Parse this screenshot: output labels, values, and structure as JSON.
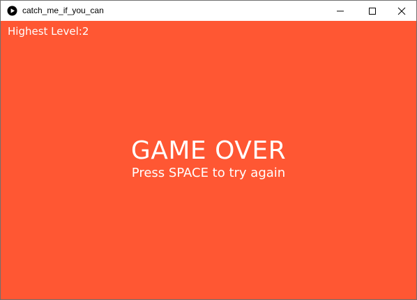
{
  "window": {
    "title": "catch_me_if_you_can",
    "app_icon": "play-circle-icon",
    "controls": [
      "minimize-icon",
      "maximize-icon",
      "close-icon"
    ]
  },
  "game": {
    "background_color": "#ff5733",
    "text_color": "#ffffff",
    "hud": {
      "label": "Highest Level:",
      "value": "2"
    },
    "message": {
      "title": "GAME OVER",
      "subtitle": "Press SPACE to try again"
    }
  }
}
